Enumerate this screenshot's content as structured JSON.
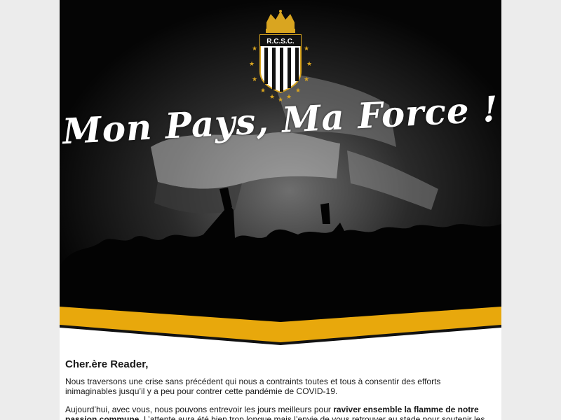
{
  "hero": {
    "logo_text": "R.C.S.C.",
    "headline": "Mon Pays, Ma Force !"
  },
  "letter": {
    "greeting": "Cher.ère Reader,",
    "paragraph1": "Nous traversons une crise sans précédent qui nous a contraints toutes et tous à consentir des efforts inimaginables jusqu’il y a peu pour contrer cette pandémie de COVID-19.",
    "paragraph2_lead": "Aujourd’hui, avec vous, nous pouvons entrevoir les jours meilleurs pour ",
    "paragraph2_bold": "raviver ensemble la flamme de notre passion commune",
    "paragraph2_tail": ". L’attente aura été bien trop longue mais l’envie de vous retrouver au stade pour soutenir les"
  },
  "colors": {
    "page_background": "#ececec",
    "accent_yellow": "#e8a80c",
    "logo_gold": "#d9a520",
    "hero_dark": "#050505"
  }
}
